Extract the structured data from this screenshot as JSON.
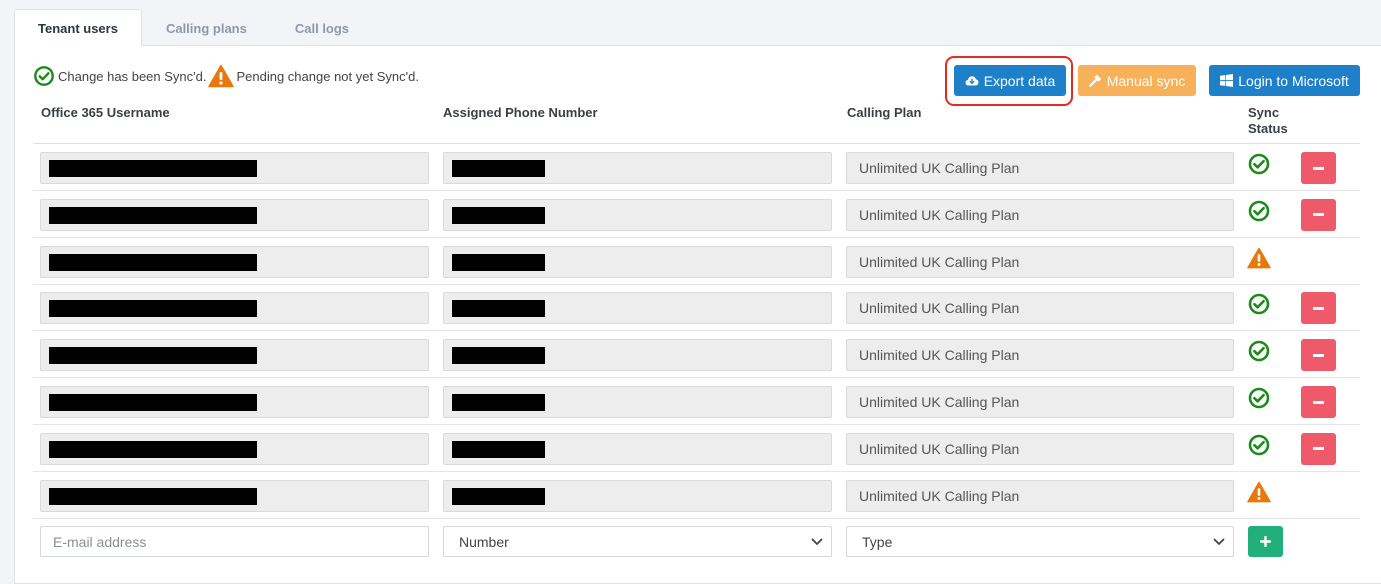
{
  "tabs": [
    {
      "label": "Tenant users",
      "active": true
    },
    {
      "label": "Calling plans",
      "active": false
    },
    {
      "label": "Call logs",
      "active": false
    }
  ],
  "legend": {
    "synced_text": "Change has been Sync'd.",
    "pending_text": "Pending change not yet Sync'd."
  },
  "toolbar": {
    "export_label": "Export data",
    "sync_label": "Manual sync",
    "login_label": "Login to Microsoft"
  },
  "table": {
    "headers": {
      "user": "Office 365 Username",
      "phone": "Assigned Phone Number",
      "plan": "Calling Plan",
      "sync_line1": "Sync",
      "sync_line2": "Status"
    },
    "rows": [
      {
        "plan": "Unlimited UK Calling Plan",
        "status": "synced",
        "removable": true
      },
      {
        "plan": "Unlimited UK Calling Plan",
        "status": "synced",
        "removable": true
      },
      {
        "plan": "Unlimited UK Calling Plan",
        "status": "pending",
        "removable": false
      },
      {
        "plan": "Unlimited UK Calling Plan",
        "status": "synced",
        "removable": true
      },
      {
        "plan": "Unlimited UK Calling Plan",
        "status": "synced",
        "removable": true
      },
      {
        "plan": "Unlimited UK Calling Plan",
        "status": "synced",
        "removable": true
      },
      {
        "plan": "Unlimited UK Calling Plan",
        "status": "synced",
        "removable": true
      },
      {
        "plan": "Unlimited UK Calling Plan",
        "status": "pending",
        "removable": false
      }
    ]
  },
  "add_form": {
    "email_placeholder": "E-mail address",
    "number_selected": "Number",
    "type_selected": "Type"
  },
  "icons": {
    "synced": "check-circle-icon",
    "pending": "warning-triangle-icon",
    "export": "cloud-download-icon",
    "sync": "hammer-icon",
    "login": "windows-icon",
    "remove": "minus-icon",
    "add": "plus-icon"
  },
  "colors": {
    "primary": "#1e80c8",
    "warning": "#f7b15b",
    "danger": "#ef5a6b",
    "success": "#21b07c",
    "synced_green": "#1b8a1b",
    "pending_orange": "#e8780c",
    "highlight_red": "#e42b1f"
  }
}
